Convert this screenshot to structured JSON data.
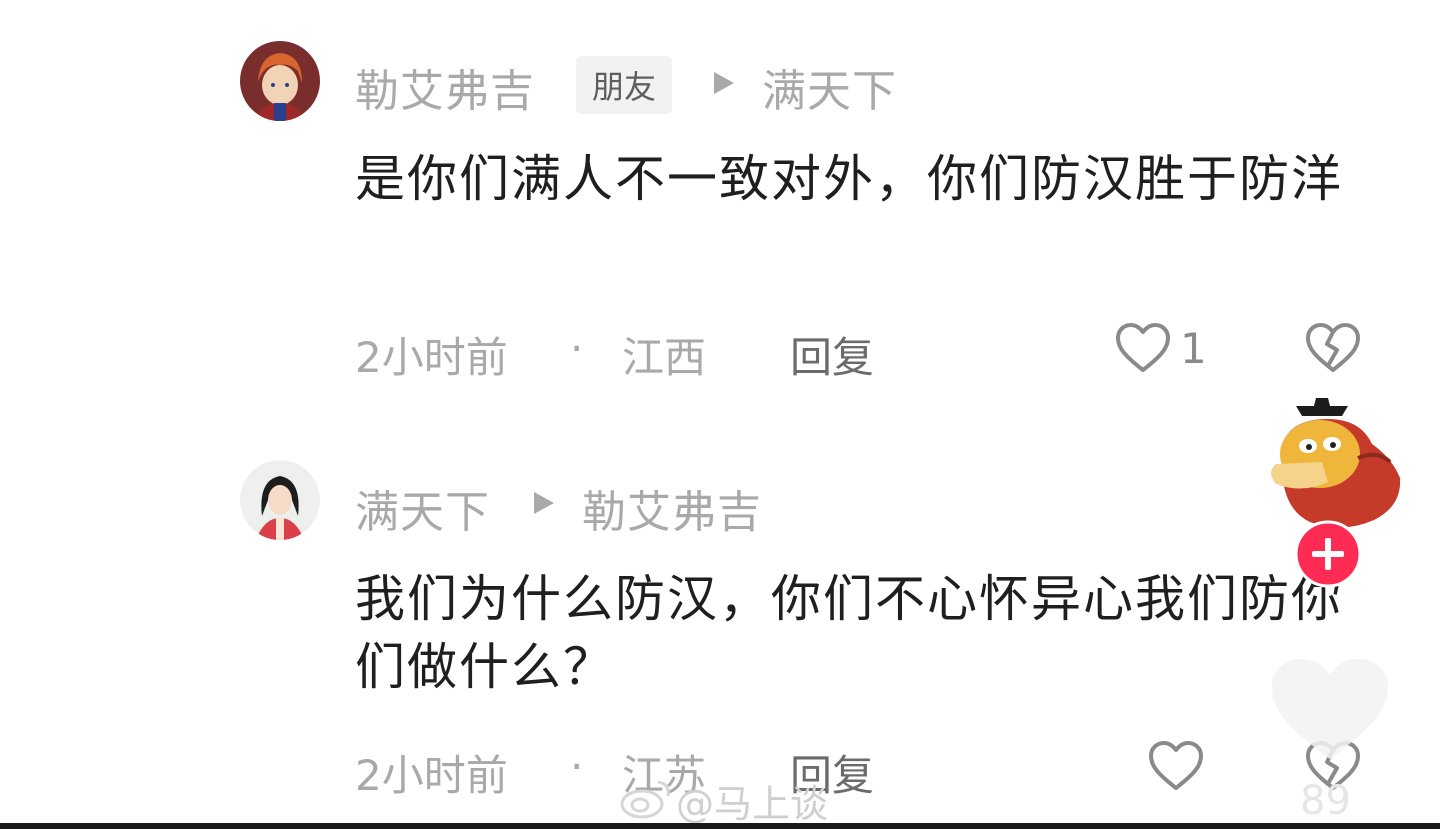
{
  "comments": [
    {
      "author": "勒艾弗吉",
      "badge": "朋友",
      "reply_to": "满天下",
      "text": "是你们满人不一致对外，你们防汉胜于防洋",
      "time": "2小时前",
      "separator": "·",
      "location": "江西",
      "reply_label": "回复",
      "like_count": "1"
    },
    {
      "author": "满天下",
      "reply_to": "勒艾弗吉",
      "text": "我们为什么防汉，你们不心怀异心我们防你们做什么？",
      "time": "2小时前",
      "separator": "·",
      "location": "江苏",
      "reply_label": "回复",
      "like_count": ""
    }
  ],
  "floating": {
    "plus_icon": "plus-icon",
    "heart_count": "89"
  },
  "watermark": "@马上谈",
  "colors": {
    "muted": "#a9a9a9",
    "text": "#1f1f1f",
    "accent": "#fe2c55"
  }
}
